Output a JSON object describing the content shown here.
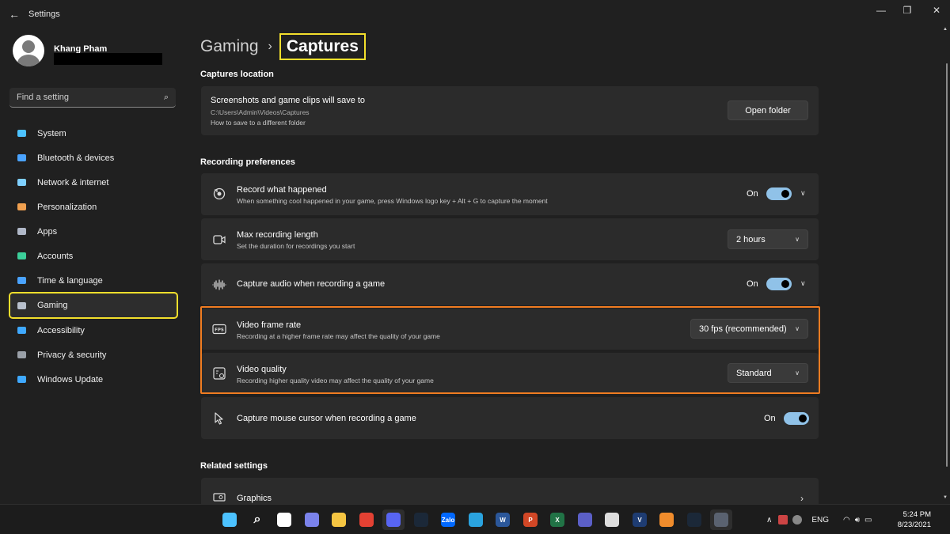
{
  "window": {
    "title": "Settings",
    "back_icon": "←",
    "minimize_icon": "—",
    "maximize_icon": "❐",
    "close_icon": "✕"
  },
  "profile": {
    "name": "Khang Pham"
  },
  "search": {
    "placeholder": "Find a setting"
  },
  "sidebar": {
    "items": [
      {
        "label": "System",
        "icon": "system-icon",
        "color": "#4cc2ff"
      },
      {
        "label": "Bluetooth & devices",
        "icon": "bluetooth-icon",
        "color": "#4aa3ff"
      },
      {
        "label": "Network & internet",
        "icon": "wifi-icon",
        "color": "#7fd0ff"
      },
      {
        "label": "Personalization",
        "icon": "brush-icon",
        "color": "#f0a050"
      },
      {
        "label": "Apps",
        "icon": "apps-icon",
        "color": "#b0b8c8"
      },
      {
        "label": "Accounts",
        "icon": "person-icon",
        "color": "#3ccf9a"
      },
      {
        "label": "Time & language",
        "icon": "globe-clock-icon",
        "color": "#4aa3ff"
      },
      {
        "label": "Gaming",
        "icon": "gamepad-icon",
        "color": "#b8c0cc",
        "active": true
      },
      {
        "label": "Accessibility",
        "icon": "accessibility-icon",
        "color": "#3fa9ff"
      },
      {
        "label": "Privacy & security",
        "icon": "shield-icon",
        "color": "#9aa0a8"
      },
      {
        "label": "Windows Update",
        "icon": "update-icon",
        "color": "#3fa9ff"
      }
    ]
  },
  "breadcrumb": {
    "parent": "Gaming",
    "separator": "›",
    "current": "Captures"
  },
  "captures_location": {
    "section_title": "Captures location",
    "title": "Screenshots and game clips will save to",
    "path": "C:\\Users\\Admin\\Videos\\Captures",
    "link": "How to save to a different folder",
    "button": "Open folder"
  },
  "recording": {
    "section_title": "Recording preferences",
    "record_what_happened": {
      "title": "Record what happened",
      "subtitle": "When something cool happened in your game, press Windows logo key + Alt + G to capture the moment",
      "state": "On"
    },
    "max_length": {
      "title": "Max recording length",
      "subtitle": "Set the duration for recordings you start",
      "value": "2 hours"
    },
    "capture_audio": {
      "title": "Capture audio when recording a game",
      "state": "On"
    },
    "frame_rate": {
      "title": "Video frame rate",
      "subtitle": "Recording at a higher frame rate may affect the quality of your game",
      "value": "30 fps (recommended)"
    },
    "quality": {
      "title": "Video quality",
      "subtitle": "Recording higher quality video may affect the quality of your game",
      "value": "Standard"
    },
    "mouse_cursor": {
      "title": "Capture mouse cursor when recording a game",
      "state": "On"
    }
  },
  "related": {
    "section_title": "Related settings",
    "graphics": "Graphics"
  },
  "taskbar": {
    "apps": [
      {
        "name": "start-icon",
        "color": "#4cc2ff",
        "glyph": ""
      },
      {
        "name": "search-icon",
        "color": "transparent",
        "glyph": "⌕"
      },
      {
        "name": "task-view-icon",
        "color": "#ffffff",
        "glyph": ""
      },
      {
        "name": "chat-icon",
        "color": "#7b83eb",
        "glyph": ""
      },
      {
        "name": "file-explorer-icon",
        "color": "#f5c542",
        "glyph": ""
      },
      {
        "name": "chrome-icon",
        "color": "#e34133",
        "glyph": ""
      },
      {
        "name": "discord-icon",
        "color": "#5865f2",
        "glyph": ""
      },
      {
        "name": "steam-icon",
        "color": "#1b2838",
        "glyph": ""
      },
      {
        "name": "zalo-icon",
        "color": "#0068ff",
        "glyph": "Zalo"
      },
      {
        "name": "telegram-icon",
        "color": "#2aa3df",
        "glyph": ""
      },
      {
        "name": "word-icon",
        "color": "#2b579a",
        "glyph": "W"
      },
      {
        "name": "powerpoint-icon",
        "color": "#d24726",
        "glyph": "P"
      },
      {
        "name": "excel-icon",
        "color": "#217346",
        "glyph": "X"
      },
      {
        "name": "app-purple-icon",
        "color": "#5b5fc7",
        "glyph": ""
      },
      {
        "name": "app-grid-icon",
        "color": "#dddddd",
        "glyph": ""
      },
      {
        "name": "vegas-icon",
        "color": "#1e3c72",
        "glyph": "V"
      },
      {
        "name": "app-orange-icon",
        "color": "#f08c2c",
        "glyph": ""
      },
      {
        "name": "steam2-icon",
        "color": "#1b2838",
        "glyph": ""
      },
      {
        "name": "settings-icon",
        "color": "#5a6270",
        "glyph": ""
      }
    ],
    "language": "ENG",
    "time": "5:24 PM",
    "date": "8/23/2021"
  }
}
